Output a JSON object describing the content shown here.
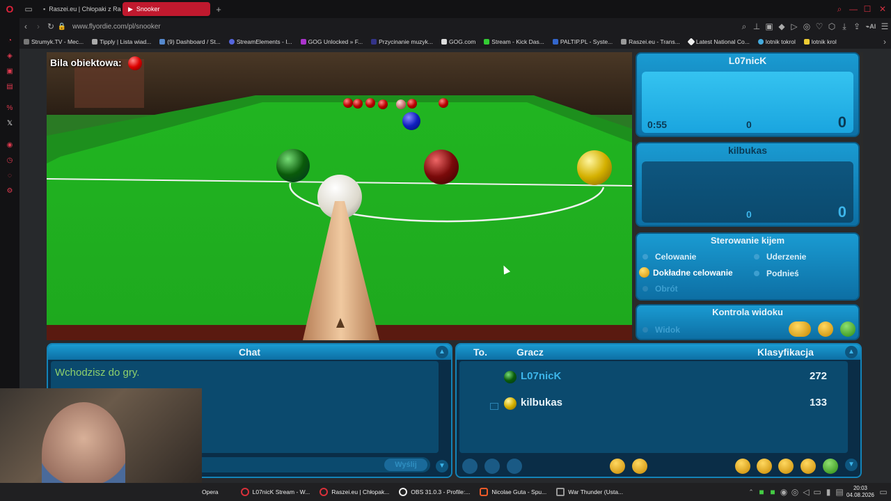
{
  "browser": {
    "tabs": [
      {
        "label": "Raszei.eu | Chłopaki z Ras..."
      },
      {
        "label": "Snooker"
      }
    ],
    "url": "www.flyordie.com/pl/snooker",
    "bookmarks": [
      "Strumyk.TV - Mec...",
      "Tipply | Lista wiad...",
      "(9) Dashboard / St...",
      "StreamElements - I...",
      "GOG Unlocked » F...",
      "Przycinanie muzyk...",
      "GOG.com",
      "Stream - Kick Das...",
      "PALTIP.PL - Syste...",
      "Raszei.eu - Trans...",
      "Latest National Co...",
      "lotnik tokrol",
      "lotnik krol"
    ]
  },
  "game": {
    "object_ball_label": "Bila obiektowa:"
  },
  "players": {
    "p1": {
      "name": "L07nicK",
      "time": "0:55",
      "break": "0",
      "score": "0"
    },
    "p2": {
      "name": "kilbukas",
      "break": "0",
      "score": "0"
    }
  },
  "cue_control": {
    "title": "Sterowanie kijem",
    "options": {
      "aim": "Celowanie",
      "strike": "Uderzenie",
      "fine_aim": "Dokładne celowanie",
      "lift": "Podnieś",
      "spin": "Obrót"
    }
  },
  "view_control": {
    "title": "Kontrola widoku",
    "view": "Widok"
  },
  "chat": {
    "title": "Chat",
    "message": "Wchodzisz do gry.",
    "send": "Wyślij"
  },
  "ranking": {
    "col_turn": "To.",
    "col_player": "Gracz",
    "col_rating": "Klasyfikacja",
    "rows": [
      {
        "name": "L07nicK",
        "rating": "272"
      },
      {
        "name": "kilbukas",
        "rating": "133"
      }
    ]
  },
  "taskbar": {
    "items": [
      "Opera",
      "L07nicK Stream - W...",
      "Raszei.eu | Chłopak...",
      "OBS 31.0.3 - Profile:...",
      "Nicolae Guta - Spu...",
      "War Thunder (Usta..."
    ],
    "time": "20:03",
    "date": "04.08.2026"
  }
}
